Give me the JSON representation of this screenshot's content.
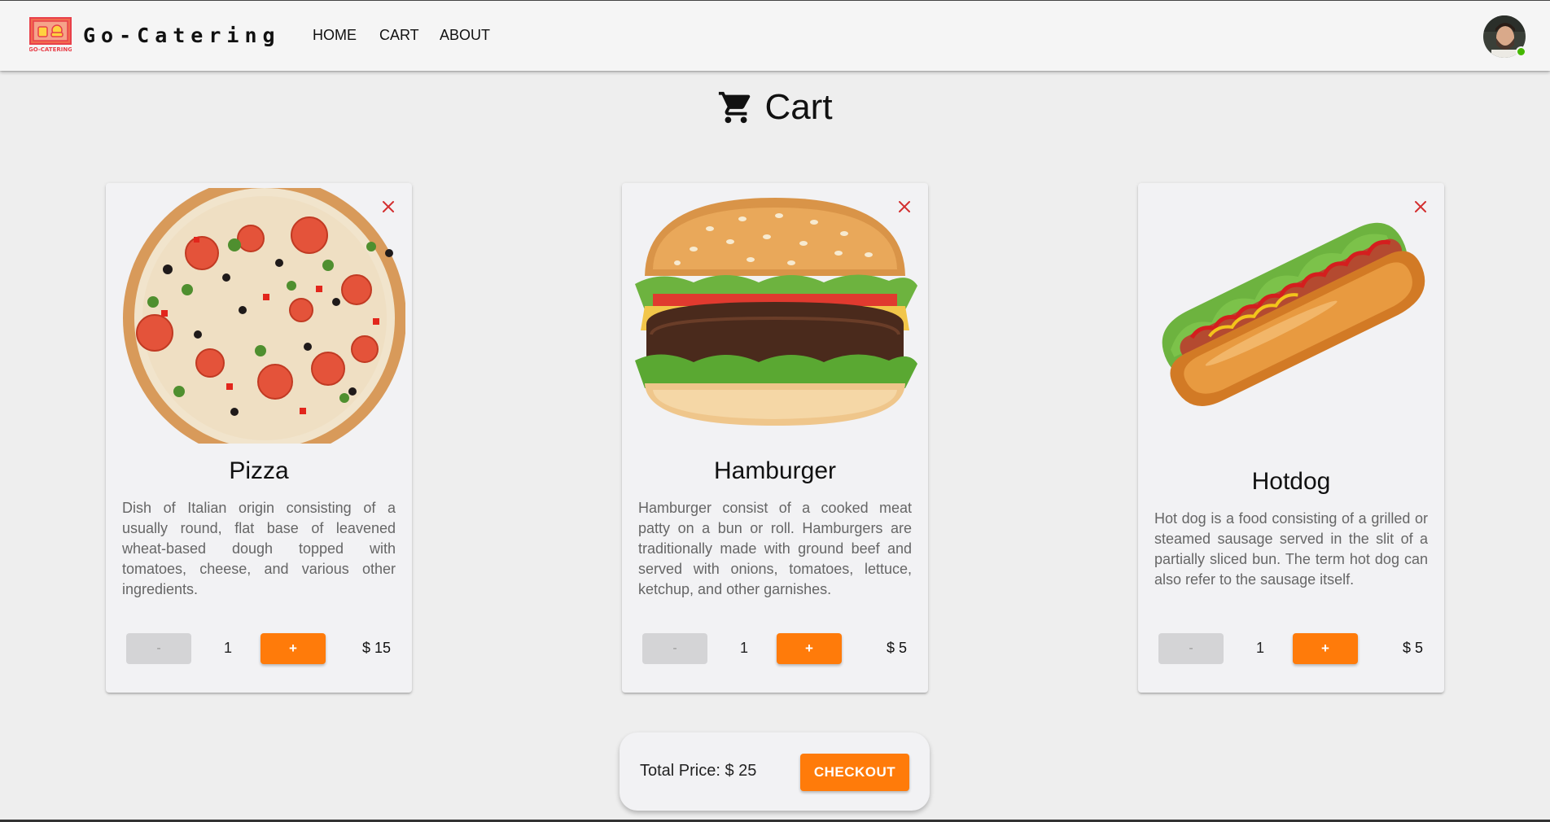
{
  "header": {
    "logo_text": "GO-CATERING",
    "brand": "Go-Catering",
    "nav": [
      "HOME",
      "CART",
      "ABOUT"
    ]
  },
  "page": {
    "title": "Cart",
    "icon": "shopping-cart-icon"
  },
  "cart_items": [
    {
      "name": "Pizza",
      "description": "Dish of Italian origin consisting of a usually round, flat base of leavened wheat-based dough topped with tomatoes, cheese, and various other ingredients.",
      "minus_label": "-",
      "quantity": "1",
      "plus_label": "+",
      "price": "$ 15"
    },
    {
      "name": "Hamburger",
      "description": "Hamburger consist of a cooked meat patty on a bun or roll. Hamburgers are traditionally made with ground beef and served with onions, tomatoes, lettuce, ketchup, and other garnishes.",
      "minus_label": "-",
      "quantity": "1",
      "plus_label": "+",
      "price": "$ 5"
    },
    {
      "name": "Hotdog",
      "description": "Hot dog is a food consisting of a grilled or steamed sausage served in the slit of a partially sliced bun. The term hot dog can also refer to the sausage itself.",
      "minus_label": "-",
      "quantity": "1",
      "plus_label": "+",
      "price": "$ 5"
    }
  ],
  "summary": {
    "total": "Total Price: $ 25",
    "checkout_label": "CHECKOUT"
  },
  "colors": {
    "accent": "#ff7b0a",
    "remove": "#d32f2f",
    "background": "#eeeeee",
    "card": "#f2f2f4"
  }
}
